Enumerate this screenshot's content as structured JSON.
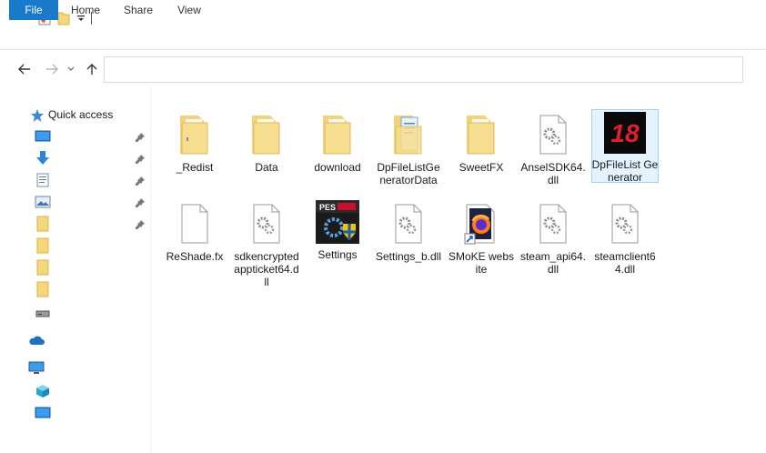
{
  "ribbon": {
    "tabs": [
      {
        "label": "File"
      },
      {
        "label": "Home"
      },
      {
        "label": "Share"
      },
      {
        "label": "View"
      }
    ]
  },
  "address": {
    "value": ""
  },
  "sidebar": {
    "quick_access_label": "Quick access"
  },
  "files": [
    {
      "name": "_Redist",
      "icon": "folder-icon"
    },
    {
      "name": "Data",
      "icon": "folder-icon"
    },
    {
      "name": "download",
      "icon": "folder-icon"
    },
    {
      "name": "DpFileListGeneratorData",
      "icon": "folder-doc-icon"
    },
    {
      "name": "SweetFX",
      "icon": "folder-icon"
    },
    {
      "name": "AnselSDK64.dll",
      "icon": "dll-gear-icon"
    },
    {
      "name": "DpFileList Generator",
      "icon": "app-18-icon"
    },
    {
      "name": "ReShade.fx",
      "icon": "blank-file-icon"
    },
    {
      "name": "sdkencryptedappticket64.dll",
      "icon": "dll-gear-icon"
    },
    {
      "name": "Settings",
      "icon": "pes-settings-icon"
    },
    {
      "name": "Settings_b.dll",
      "icon": "dll-gear-icon"
    },
    {
      "name": "SMoKE website",
      "icon": "firefox-shortcut-icon"
    },
    {
      "name": "steam_api64.dll",
      "icon": "dll-gear-icon"
    },
    {
      "name": "steamclient64.dll",
      "icon": "dll-gear-icon"
    }
  ],
  "colors": {
    "accent": "#1979ca",
    "folder": "#f5d67a",
    "selection": "#e5f3ff"
  }
}
